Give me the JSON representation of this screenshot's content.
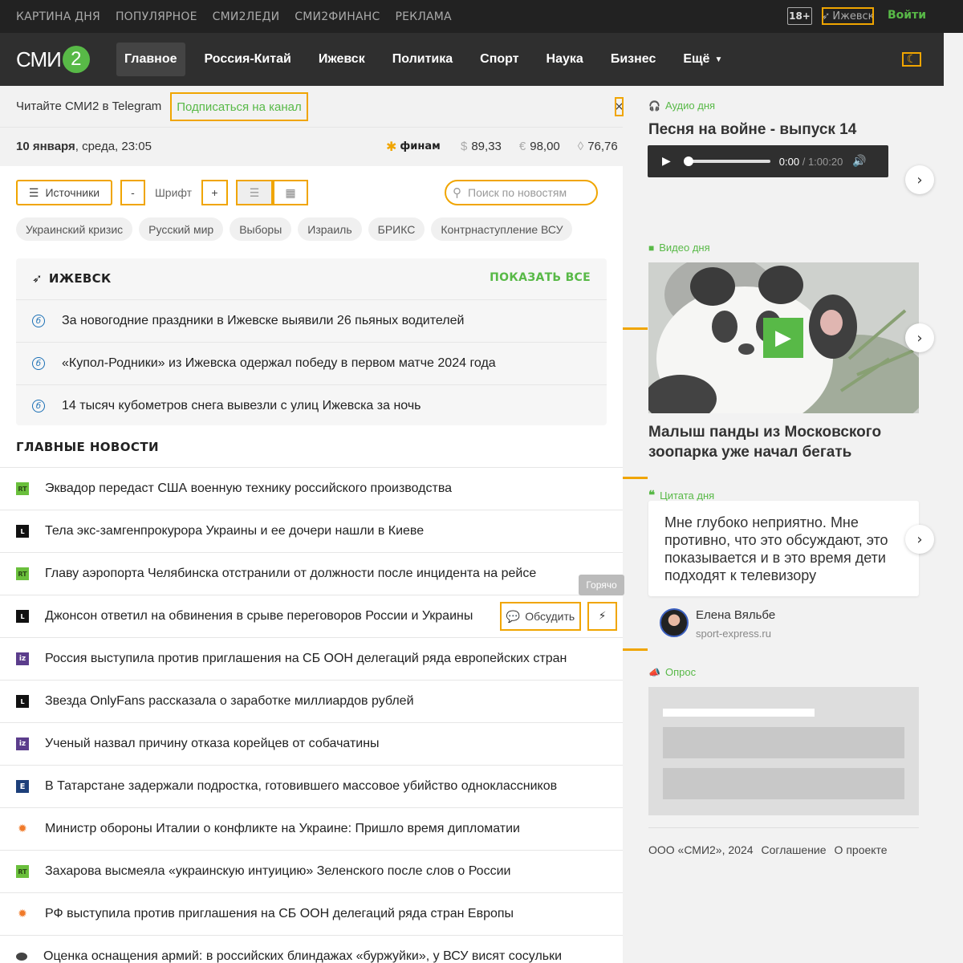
{
  "topbar": {
    "links": [
      "КАРТИНА ДНЯ",
      "ПОПУЛЯРНОЕ",
      "СМИ2ЛЕДИ",
      "СМИ2ФИНАНС",
      "РЕКЛАМА"
    ],
    "age": "18+",
    "city": "Ижевск",
    "login": "Войти"
  },
  "logo": {
    "text": "СМИ",
    "num": "2"
  },
  "menu": [
    "Главное",
    "Россия-Китай",
    "Ижевск",
    "Политика",
    "Спорт",
    "Наука",
    "Бизнес",
    "Ещё"
  ],
  "telegram": {
    "text": "Читайте СМИ2 в Telegram",
    "button": "Подписаться на канал",
    "close": "×"
  },
  "date": {
    "day": "10 января",
    "rest": ", среда, 23:05"
  },
  "finam": "финам",
  "rates": [
    {
      "symbol": "$",
      "value": "89,33"
    },
    {
      "symbol": "€",
      "value": "98,00"
    },
    {
      "symbol": "💧",
      "value": "76,76"
    }
  ],
  "controls": {
    "sources": "Источники",
    "minus": "-",
    "font": "Шрифт",
    "plus": "+",
    "search_placeholder": "Поиск по новостям"
  },
  "tags": [
    "Украинский кризис",
    "Русский мир",
    "Выборы",
    "Израиль",
    "БРИКС",
    "Контрнаступление ВСУ"
  ],
  "city_block": {
    "title": "ИЖЕВСК",
    "show_all": "ПОКАЗАТЬ ВСЕ",
    "items": [
      "За новогодние праздники в Ижевске выявили 26 пьяных водителей",
      "«Купол-Родники» из Ижевска одержал победу в первом матче 2024 года",
      "14 тысяч кубометров снега вывезли с улиц Ижевска за ночь"
    ]
  },
  "main_news": {
    "title": "ГЛАВНЫЕ НОВОСТИ",
    "discuss": "Обсудить",
    "hot_tip": "Горячо",
    "items": [
      {
        "src": "rt",
        "src_label": "RT",
        "text": "Эквадор передаст США военную технику российского производства"
      },
      {
        "src": "l",
        "src_label": "L",
        "text": "Тела экс-замгенпрокурора Украины и ее дочери нашли в Киеве"
      },
      {
        "src": "rt",
        "src_label": "RT",
        "text": "Главу аэропорта Челябинска отстранили от должности после инцидента на рейсе"
      },
      {
        "src": "l",
        "src_label": "L",
        "text": "Джонсон ответил на обвинения в срыве переговоров России и Украины"
      },
      {
        "src": "iz",
        "src_label": "iz",
        "text": "Россия выступила против приглашения на СБ ООН делегаций ряда европейских стран"
      },
      {
        "src": "l",
        "src_label": "L",
        "text": "Звезда OnlyFans рассказала о заработке миллиардов рублей"
      },
      {
        "src": "iz",
        "src_label": "iz",
        "text": "Ученый назвал причину отказа корейцев от собачатины"
      },
      {
        "src": "e",
        "src_label": "E",
        "text": "В Татарстане задержали подростка, готовившего массовое убийство одноклассников"
      },
      {
        "src": "fire",
        "src_label": "",
        "text": "Министр обороны Италии о конфликте на Украине: Пришло время дипломатии"
      },
      {
        "src": "rt",
        "src_label": "RT",
        "text": "Захарова высмеяла «украинскую интуицию» Зеленского после слов о России"
      },
      {
        "src": "fire",
        "src_label": "",
        "text": "РФ выступила против приглашения на СБ ООН делегаций ряда стран Европы"
      },
      {
        "src": "dot",
        "src_label": "",
        "text": "Оценка оснащения армий: в российских блиндажах «буржуйки», у ВСУ висят сосульки"
      }
    ]
  },
  "audio": {
    "label": "Аудио дня",
    "title": "Песня на войне - выпуск 14",
    "time": "0:00",
    "sep": " / ",
    "duration": "1:00:20"
  },
  "video": {
    "label": "Видео дня",
    "title": "Малыш панды из Московского зоопарка уже начал бегать"
  },
  "quote": {
    "label": "Цитата дня",
    "text": "Мне глубоко неприятно. Мне противно, что это обсуждают, это показывается и в это время дети подходят к телевизору",
    "author": "Елена Вяльбе",
    "source": "sport-express.ru"
  },
  "poll": {
    "label": "Опрос"
  },
  "footer": [
    "ООО «СМИ2», 2024",
    "Соглашение",
    "О проекте"
  ],
  "colors": {
    "accent": "#58b947",
    "highlight": "#f0a500",
    "dark": "#2f2f2f"
  }
}
